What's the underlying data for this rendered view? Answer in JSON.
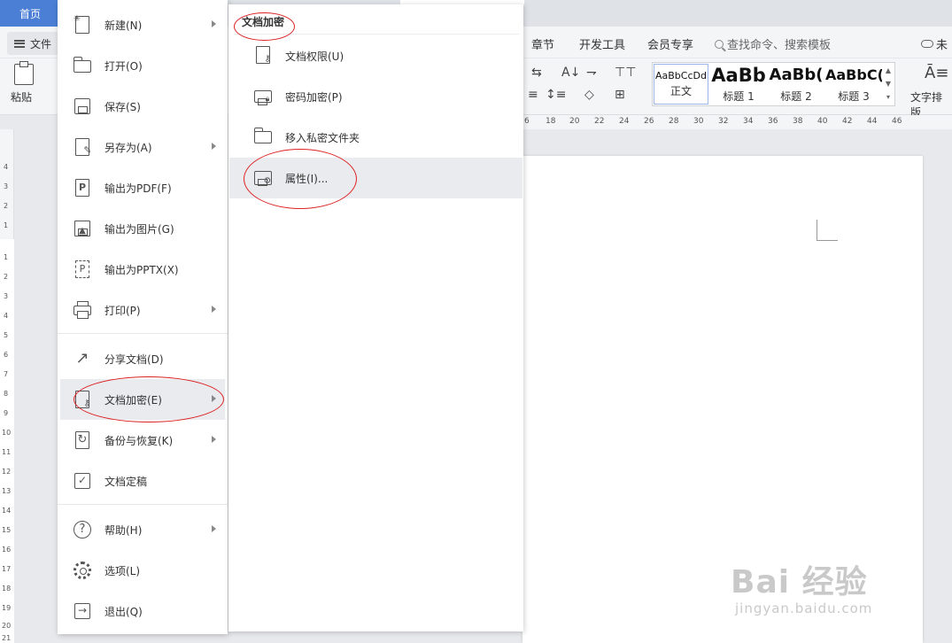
{
  "tabs": {
    "home": "首页"
  },
  "menubar": {
    "file_label": "文件",
    "items": [
      "章节",
      "开发工具",
      "会员专享"
    ],
    "search_placeholder": "查找命令、搜索模板",
    "cloud_label": "未"
  },
  "ribbon": {
    "paste_label": "粘贴",
    "styles": [
      {
        "sample": "AaBbCcDd",
        "name": "正文"
      },
      {
        "sample": "AaBb",
        "name": "标题 1"
      },
      {
        "sample": "AaBb(",
        "name": "标题 2"
      },
      {
        "sample": "AaBbC(",
        "name": "标题 3"
      }
    ],
    "text_layout_label": "文字排版"
  },
  "ruler": {
    "h_ticks": [
      "6",
      "18",
      "20",
      "22",
      "24",
      "26",
      "28",
      "30",
      "32",
      "34",
      "36",
      "38",
      "40",
      "42",
      "44",
      "46"
    ],
    "v_ticks": [
      "4",
      "3",
      "2",
      "1",
      "1",
      "2",
      "3",
      "4",
      "5",
      "6",
      "7",
      "8",
      "9",
      "10",
      "11",
      "12",
      "13",
      "14",
      "15",
      "16",
      "17",
      "18",
      "19",
      "20",
      "21"
    ]
  },
  "file_menu": {
    "items": [
      {
        "label": "新建(N)",
        "icon": "new-document-icon",
        "submenu": true
      },
      {
        "label": "打开(O)",
        "icon": "open-folder-icon",
        "submenu": false
      },
      {
        "label": "保存(S)",
        "icon": "save-icon",
        "submenu": false
      },
      {
        "label": "另存为(A)",
        "icon": "save-as-icon",
        "submenu": true
      },
      {
        "label": "输出为PDF(F)",
        "icon": "export-pdf-icon",
        "submenu": false
      },
      {
        "label": "输出为图片(G)",
        "icon": "export-image-icon",
        "submenu": false
      },
      {
        "label": "输出为PPTX(X)",
        "icon": "export-pptx-icon",
        "submenu": false
      },
      {
        "label": "打印(P)",
        "icon": "printer-icon",
        "submenu": true
      },
      {
        "label": "分享文档(D)",
        "icon": "share-icon",
        "submenu": false
      },
      {
        "label": "文档加密(E)",
        "icon": "document-encrypt-icon",
        "submenu": true,
        "active": true
      },
      {
        "label": "备份与恢复(K)",
        "icon": "backup-restore-icon",
        "submenu": true
      },
      {
        "label": "文档定稿",
        "icon": "document-finalize-icon",
        "submenu": false
      },
      {
        "label": "帮助(H)",
        "icon": "help-icon",
        "submenu": true
      },
      {
        "label": "选项(L)",
        "icon": "options-gear-icon",
        "submenu": false
      },
      {
        "label": "退出(Q)",
        "icon": "exit-icon",
        "submenu": false
      }
    ]
  },
  "sub_menu": {
    "title": "文档加密",
    "items": [
      {
        "label": "文档权限(U)",
        "icon": "document-permission-icon"
      },
      {
        "label": "密码加密(P)",
        "icon": "password-encrypt-icon"
      },
      {
        "label": "移入私密文件夹",
        "icon": "private-folder-icon"
      },
      {
        "label": "属性(I)...",
        "icon": "properties-icon",
        "active": true
      }
    ]
  },
  "watermark": {
    "brand": "Bai 经验",
    "url": "jingyan.baidu.com"
  },
  "colors": {
    "accent": "#4b7fd6",
    "annotation": "#dd2222",
    "hover": "#e9ebef"
  }
}
